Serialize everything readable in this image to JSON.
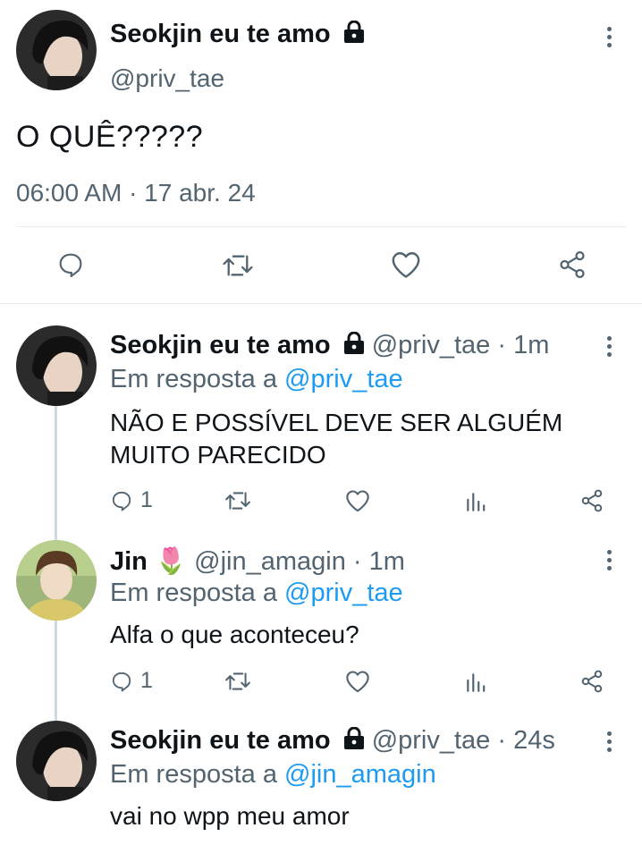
{
  "main_tweet": {
    "display_name": "Seokjin eu te amo",
    "handle": "@priv_tae",
    "text": "O QUÊ?????",
    "timestamp": "06:00 AM · 17 abr. 24"
  },
  "action_bar": {
    "reply_icon": "reply-icon",
    "retweet_icon": "retweet-icon",
    "like_icon": "heart-icon",
    "share_icon": "share-icon"
  },
  "replies": [
    {
      "display_name": "Seokjin eu te amo",
      "handle": "@priv_tae",
      "time": "1m",
      "reply_prefix": "Em resposta a",
      "reply_to": "@priv_tae",
      "text_line1": "NÃO E POSSÍVEL DEVE SER ALGUÉM",
      "text_line2": "MUITO PARECIDO",
      "reply_count": "1"
    },
    {
      "display_name": "Jin",
      "emoji": "🌷",
      "handle": "@jin_amagin",
      "time": "1m",
      "reply_prefix": "Em resposta a",
      "reply_to": "@priv_tae",
      "text": "Alfa o que aconteceu?",
      "reply_count": "1"
    },
    {
      "display_name": "Seokjin eu te amo",
      "handle": "@priv_tae",
      "time": "24s",
      "reply_prefix": "Em resposta a",
      "reply_to": "@jin_amagin",
      "text": "vai no wpp meu amor"
    }
  ],
  "colors": {
    "text": "#0f1419",
    "secondary": "#536471",
    "link": "#1d9bf0",
    "divider": "#e6ecf0"
  }
}
